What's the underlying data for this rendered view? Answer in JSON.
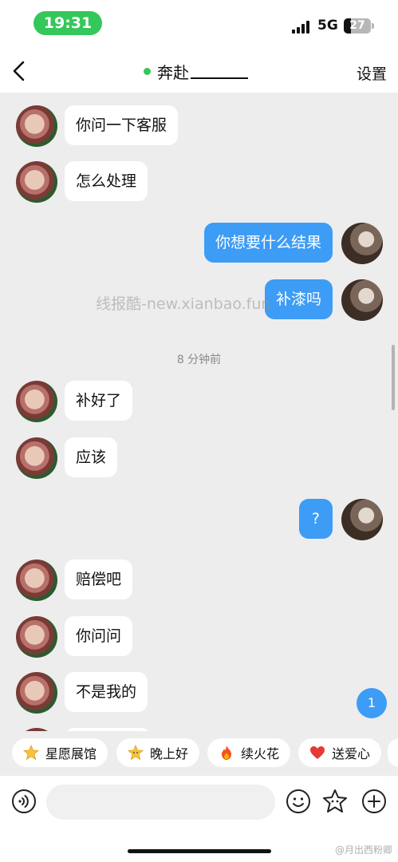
{
  "status_bar": {
    "time": "19:31",
    "network": "5G",
    "battery": "27"
  },
  "nav": {
    "title": "奔赴",
    "settings": "设置"
  },
  "messages": [
    {
      "side": "left",
      "text": "你问一下客服"
    },
    {
      "side": "left",
      "text": "怎么处理"
    },
    {
      "side": "right",
      "text": "你想要什么结果"
    },
    {
      "side": "right",
      "text": "补漆吗"
    },
    {
      "side": "left",
      "text": "补好了"
    },
    {
      "side": "left",
      "text": "应该"
    },
    {
      "side": "right",
      "text": "?"
    },
    {
      "side": "left",
      "text": "赔偿吧"
    },
    {
      "side": "left",
      "text": "你问问"
    },
    {
      "side": "left",
      "text": "不是我的"
    }
  ],
  "timestamp": "8 分钟前",
  "watermark": "线报酷-new.xianbao.fun",
  "unread_count": "1",
  "quick_replies": [
    {
      "label": "星愿展馆",
      "icon": "star-icon",
      "color": "#f5c242"
    },
    {
      "label": "晚上好",
      "icon": "star-face-icon",
      "color": "#f5c242"
    },
    {
      "label": "续火花",
      "icon": "fire-icon",
      "color": "#f4511e"
    },
    {
      "label": "送爱心",
      "icon": "heart-icon",
      "color": "#e53935"
    }
  ],
  "input": {
    "placeholder": ""
  },
  "corner_mark": "@月出西粉卿"
}
